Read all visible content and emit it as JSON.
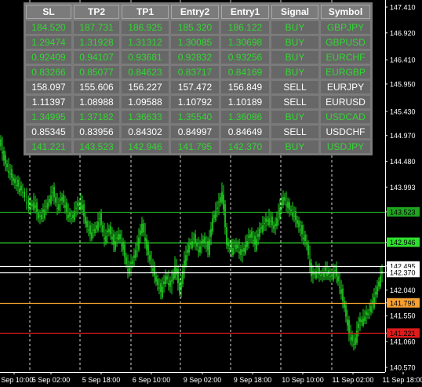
{
  "price_axis": {
    "labels": [
      "147.410",
      "146.920",
      "146.410",
      "145.950",
      "145.430",
      "144.970",
      "144.480",
      "143.993",
      "143.523",
      "142.946",
      "142.495",
      "142.370",
      "142.040",
      "141.795",
      "141.550",
      "141.221",
      "141.060",
      "140.570"
    ],
    "values": [
      147.41,
      146.92,
      146.41,
      145.95,
      145.43,
      144.97,
      144.48,
      143.993,
      143.523,
      142.946,
      142.495,
      142.37,
      142.04,
      141.795,
      141.55,
      141.221,
      141.06,
      140.57
    ],
    "marked_prices": [
      {
        "label": "143.523",
        "value": 143.523,
        "color": "#1fa51f",
        "type": "tp2"
      },
      {
        "label": "142.946",
        "value": 142.946,
        "color": "#2ee02e",
        "type": "tp1"
      },
      {
        "label": "142.495",
        "value": 142.495,
        "color": "#ffffff",
        "type": "line-a"
      },
      {
        "label": "142.370",
        "value": 142.37,
        "color": "#ffffff",
        "type": "entry1"
      },
      {
        "label": "141.795",
        "value": 141.795,
        "color": "#f7a132",
        "type": "entry2"
      },
      {
        "label": "141.221",
        "value": 141.221,
        "color": "#e01b1b",
        "type": "sl"
      }
    ]
  },
  "time_axis": {
    "labels": [
      "4 Sep 10:00",
      "5 Sep 02:00",
      "5 Sep 18:00",
      "6 Sep 10:00",
      "9 Sep 02:00",
      "9 Sep 18:00",
      "10 Sep 10:00",
      "11 Sep 02:00",
      "11 Sep 18:00"
    ]
  },
  "table": {
    "headers": [
      "SL",
      "TP2",
      "TP1",
      "Entry2",
      "Entry1",
      "Signal",
      "Symbol"
    ],
    "rows": [
      {
        "signal_type": "buy",
        "cells": [
          "184.520",
          "187.731",
          "186.925",
          "185.320",
          "186.122",
          "BUY",
          "GBPJPY"
        ]
      },
      {
        "signal_type": "buy",
        "cells": [
          "1.29474",
          "1.31928",
          "1.31312",
          "1.30085",
          "1.30698",
          "BUY",
          "GBPUSD"
        ]
      },
      {
        "signal_type": "buy",
        "cells": [
          "0.92409",
          "0.94107",
          "0.93681",
          "0.92832",
          "0.93256",
          "BUY",
          "EURCHF"
        ]
      },
      {
        "signal_type": "buy",
        "cells": [
          "0.83266",
          "0.85077",
          "0.84623",
          "0.83717",
          "0.84169",
          "BUY",
          "EURGBP"
        ]
      },
      {
        "signal_type": "sell",
        "cells": [
          "158.097",
          "155.606",
          "156.227",
          "157.472",
          "156.849",
          "SELL",
          "EURJPY"
        ]
      },
      {
        "signal_type": "sell",
        "cells": [
          "1.11397",
          "1.08988",
          "1.09588",
          "1.10792",
          "1.10189",
          "SELL",
          "EURUSD"
        ]
      },
      {
        "signal_type": "buy",
        "cells": [
          "1.34995",
          "1.37182",
          "1.36633",
          "1.35540",
          "1.36086",
          "BUY",
          "USDCAD"
        ]
      },
      {
        "signal_type": "sell",
        "cells": [
          "0.85345",
          "0.83956",
          "0.84302",
          "0.84997",
          "0.84649",
          "SELL",
          "USDCHF"
        ]
      },
      {
        "signal_type": "buy",
        "cells": [
          "141.221",
          "143.523",
          "142.946",
          "141.795",
          "142.370",
          "BUY",
          "USDJPY"
        ]
      }
    ]
  },
  "colors": {
    "buy": "#32d732",
    "sell": "#ffffff",
    "candle": "#22dd22",
    "grid": "#ffffff"
  }
}
